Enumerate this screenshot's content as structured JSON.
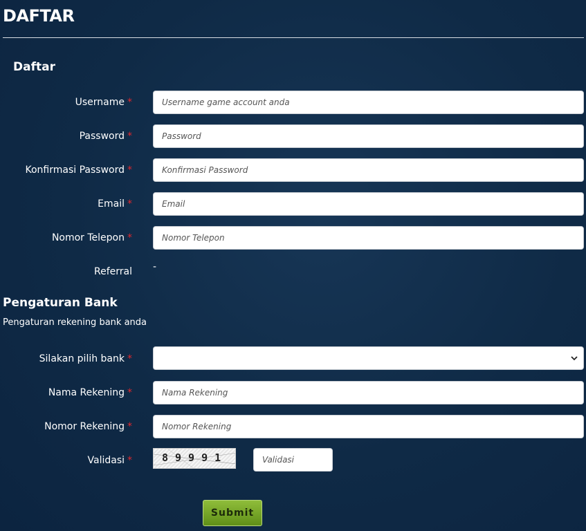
{
  "page": {
    "title": "DAFTAR"
  },
  "account_section": {
    "title": "Daftar"
  },
  "fields": {
    "username": {
      "label": "Username",
      "required": "*",
      "placeholder": "Username game account anda"
    },
    "password": {
      "label": "Password",
      "required": "*",
      "placeholder": "Password"
    },
    "confirm_password": {
      "label": "Konfirmasi Password",
      "required": "*",
      "placeholder": "Konfirmasi Password"
    },
    "email": {
      "label": "Email",
      "required": "*",
      "placeholder": "Email"
    },
    "phone": {
      "label": "Nomor Telepon",
      "required": "*",
      "placeholder": "Nomor Telepon"
    },
    "referral": {
      "label": "Referral",
      "value": "-"
    }
  },
  "bank_section": {
    "title": "Pengaturan Bank",
    "subtitle": "Pengaturan rekening bank anda",
    "bank_select": {
      "label": "Silakan pilih bank",
      "required": "*",
      "selected": ""
    },
    "account_name": {
      "label": "Nama Rekening",
      "required": "*",
      "placeholder": "Nama Rekening"
    },
    "account_number": {
      "label": "Nomor Rekening",
      "required": "*",
      "placeholder": "Nomor Rekening"
    },
    "validation": {
      "label": "Validasi",
      "required": "*",
      "captcha_text": "89991",
      "placeholder": "Validasi"
    }
  },
  "submit": {
    "label": "Submit"
  },
  "colors": {
    "background": "#0f2a46",
    "required": "#e0282e",
    "submit_button": "#7aa82a"
  },
  "icons": {
    "select_arrow": "chevron-down-icon"
  }
}
